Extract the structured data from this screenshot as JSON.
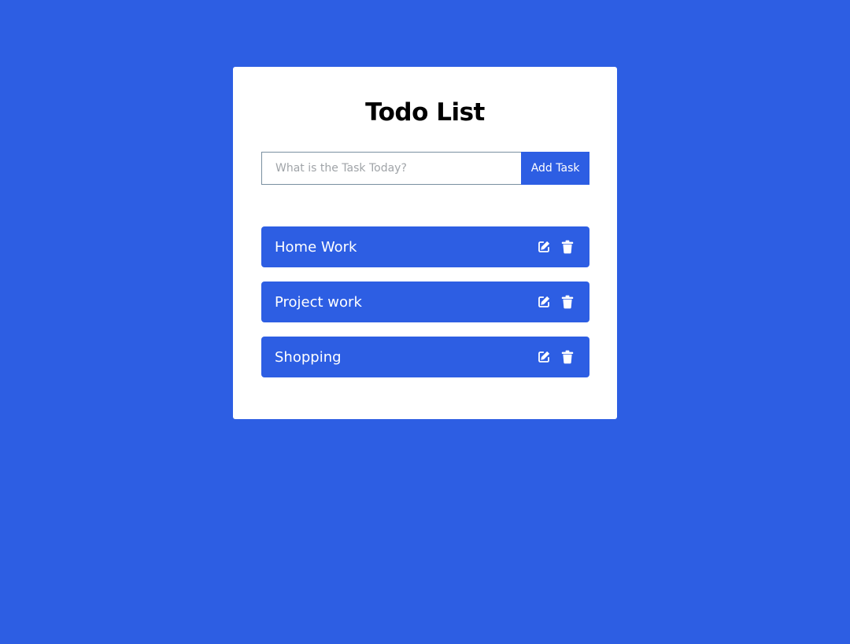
{
  "app": {
    "title": "Todo List"
  },
  "form": {
    "input_value": "",
    "input_placeholder": "What is the Task Today?",
    "add_button_label": "Add Task"
  },
  "tasks": [
    {
      "label": "Home Work"
    },
    {
      "label": "Project work"
    },
    {
      "label": "Shopping"
    }
  ],
  "icons": {
    "edit": "pen-to-square-icon",
    "delete": "trash-icon"
  },
  "colors": {
    "background": "#2d5ee3",
    "card": "#ffffff",
    "task_bg": "#2d5ee3",
    "task_text": "#ffffff",
    "title": "#000000"
  }
}
